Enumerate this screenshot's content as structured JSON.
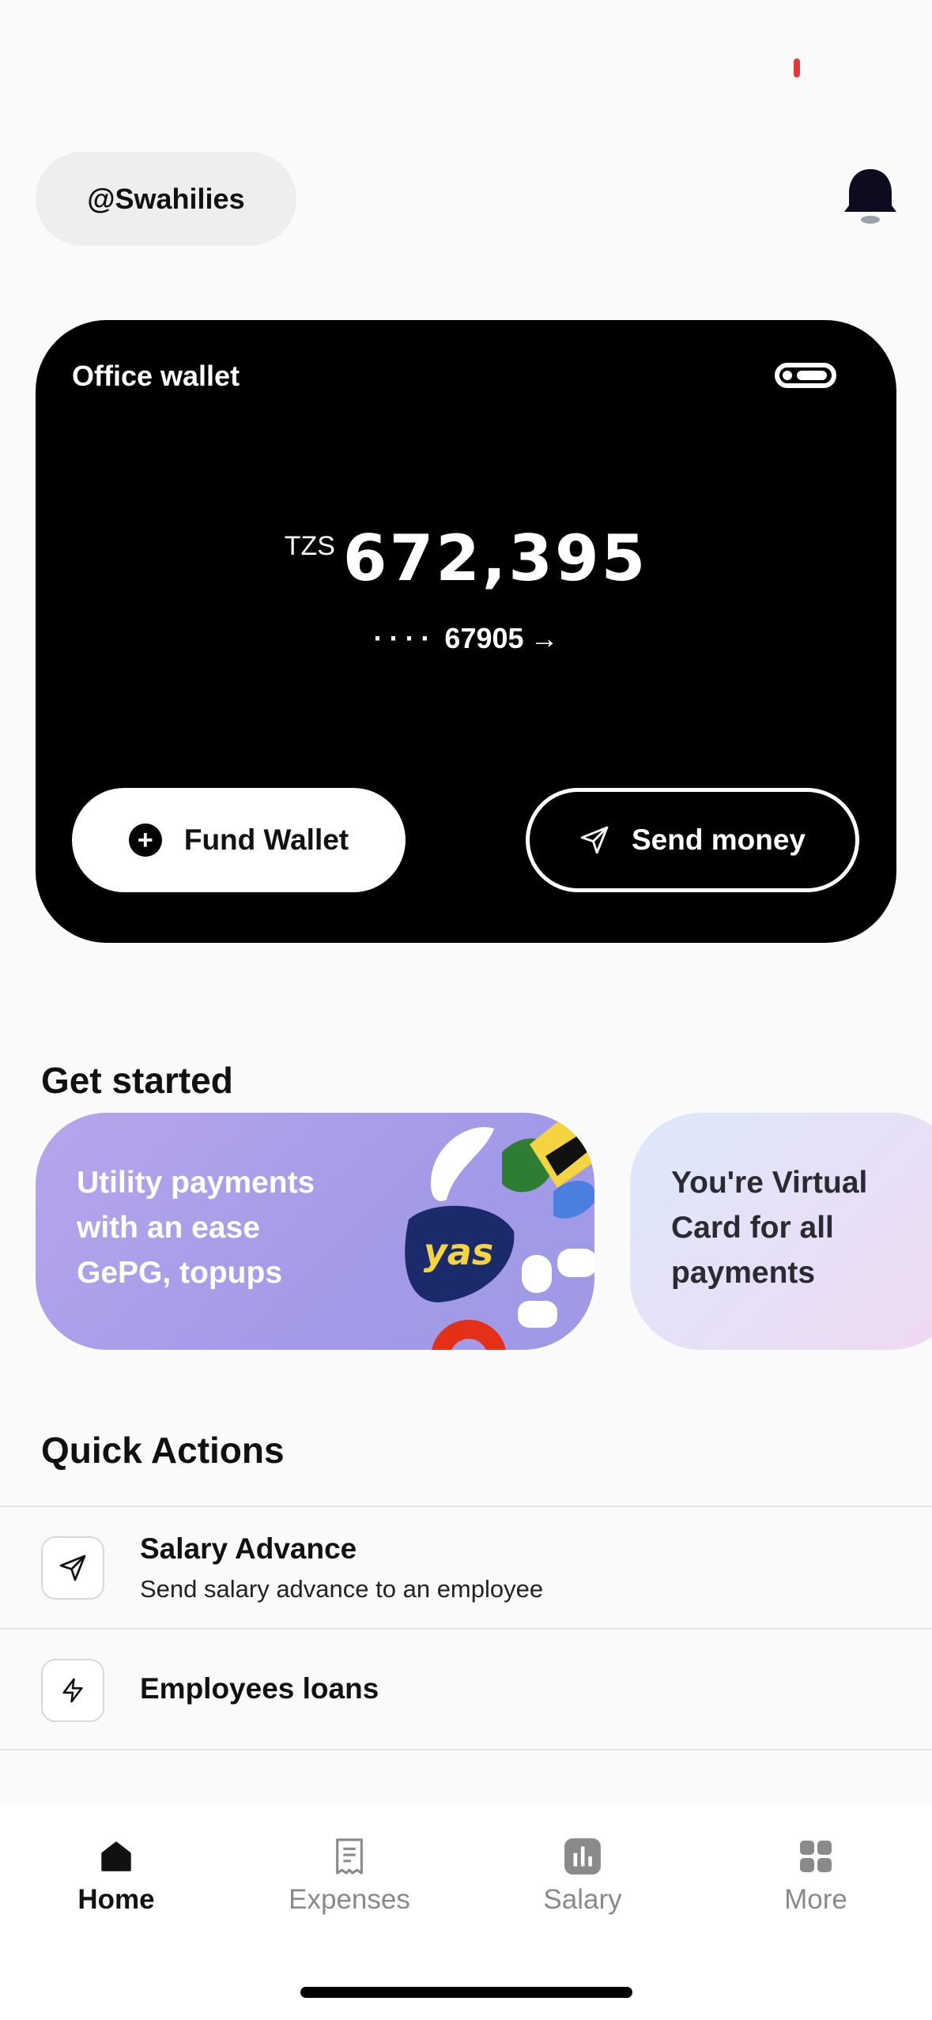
{
  "header": {
    "handle": "@Swahilies"
  },
  "wallet": {
    "title": "Office wallet",
    "currency": "TZS",
    "balance": "672,395",
    "account_dots": "····",
    "account_suffix": "67905",
    "fund_label": "Fund Wallet",
    "send_label": "Send money"
  },
  "get_started": {
    "title": "Get started",
    "cards": [
      {
        "lines": [
          "Utility payments",
          "with an ease",
          "GePG, topups"
        ],
        "logo_text": "yas"
      },
      {
        "lines": [
          "You're Virtual",
          "Card for all",
          "payments"
        ]
      }
    ]
  },
  "quick_actions": {
    "title": "Quick Actions",
    "items": [
      {
        "title": "Salary Advance",
        "subtitle": "Send salary advance to an employee",
        "icon": "send-icon"
      },
      {
        "title": "Employees loans",
        "subtitle": "",
        "icon": "lightning-icon"
      }
    ]
  },
  "tabbar": {
    "items": [
      {
        "label": "Home",
        "icon": "home-icon",
        "active": true
      },
      {
        "label": "Expenses",
        "icon": "receipt-icon",
        "active": false
      },
      {
        "label": "Salary",
        "icon": "chart-icon",
        "active": false
      },
      {
        "label": "More",
        "icon": "grid-icon",
        "active": false
      }
    ]
  },
  "colors": {
    "accent_red": "#e53935",
    "card_bg": "#000000",
    "promo_purple": "#a39ae8",
    "promo_lilac": "#e8dff6"
  }
}
